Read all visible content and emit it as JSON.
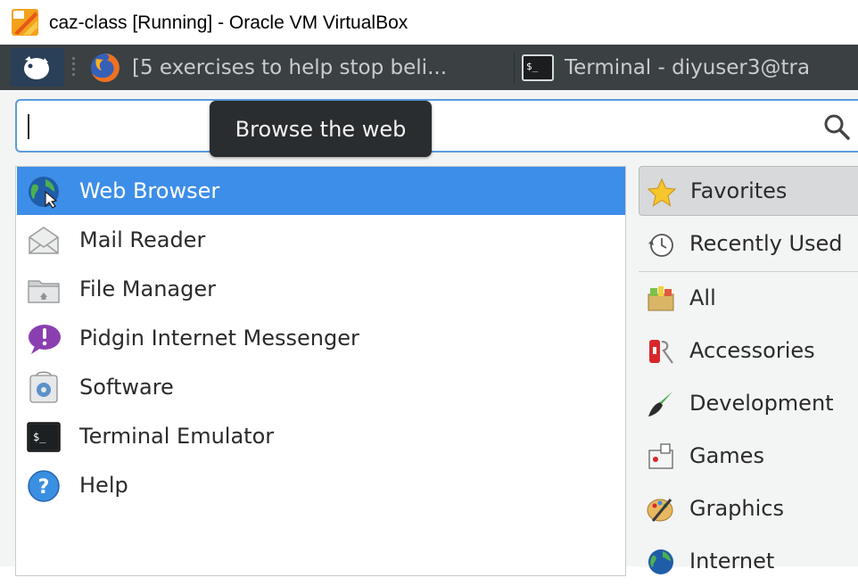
{
  "window": {
    "title": "caz-class [Running] - Oracle VM VirtualBox"
  },
  "panel": {
    "tasks": [
      {
        "label": "[5 exercises to help stop beli...",
        "icon": "firefox-icon"
      },
      {
        "label": "Terminal - diyuser3@tra",
        "icon": "terminal-icon"
      }
    ]
  },
  "menu": {
    "search": {
      "value": "",
      "placeholder": ""
    },
    "tooltip": "Browse the web",
    "apps": [
      {
        "label": "Web Browser",
        "icon": "web-browser-icon",
        "selected": true
      },
      {
        "label": "Mail Reader",
        "icon": "mail-reader-icon"
      },
      {
        "label": "File Manager",
        "icon": "file-manager-icon"
      },
      {
        "label": "Pidgin Internet Messenger",
        "icon": "pidgin-icon"
      },
      {
        "label": "Software",
        "icon": "software-icon"
      },
      {
        "label": "Terminal Emulator",
        "icon": "terminal-emulator-icon"
      },
      {
        "label": "Help",
        "icon": "help-icon"
      }
    ],
    "categories": [
      {
        "label": "Favorites",
        "icon": "star-icon",
        "selected": true
      },
      {
        "label": "Recently Used",
        "icon": "recent-icon"
      },
      {
        "label": "All",
        "icon": "all-apps-icon"
      },
      {
        "label": "Accessories",
        "icon": "accessories-icon"
      },
      {
        "label": "Development",
        "icon": "development-icon"
      },
      {
        "label": "Games",
        "icon": "games-icon"
      },
      {
        "label": "Graphics",
        "icon": "graphics-icon"
      },
      {
        "label": "Internet",
        "icon": "internet-icon"
      }
    ]
  },
  "colors": {
    "selection": "#3d8ee8",
    "panel": "#3b4043",
    "tooltip": "#2a2d2f"
  }
}
